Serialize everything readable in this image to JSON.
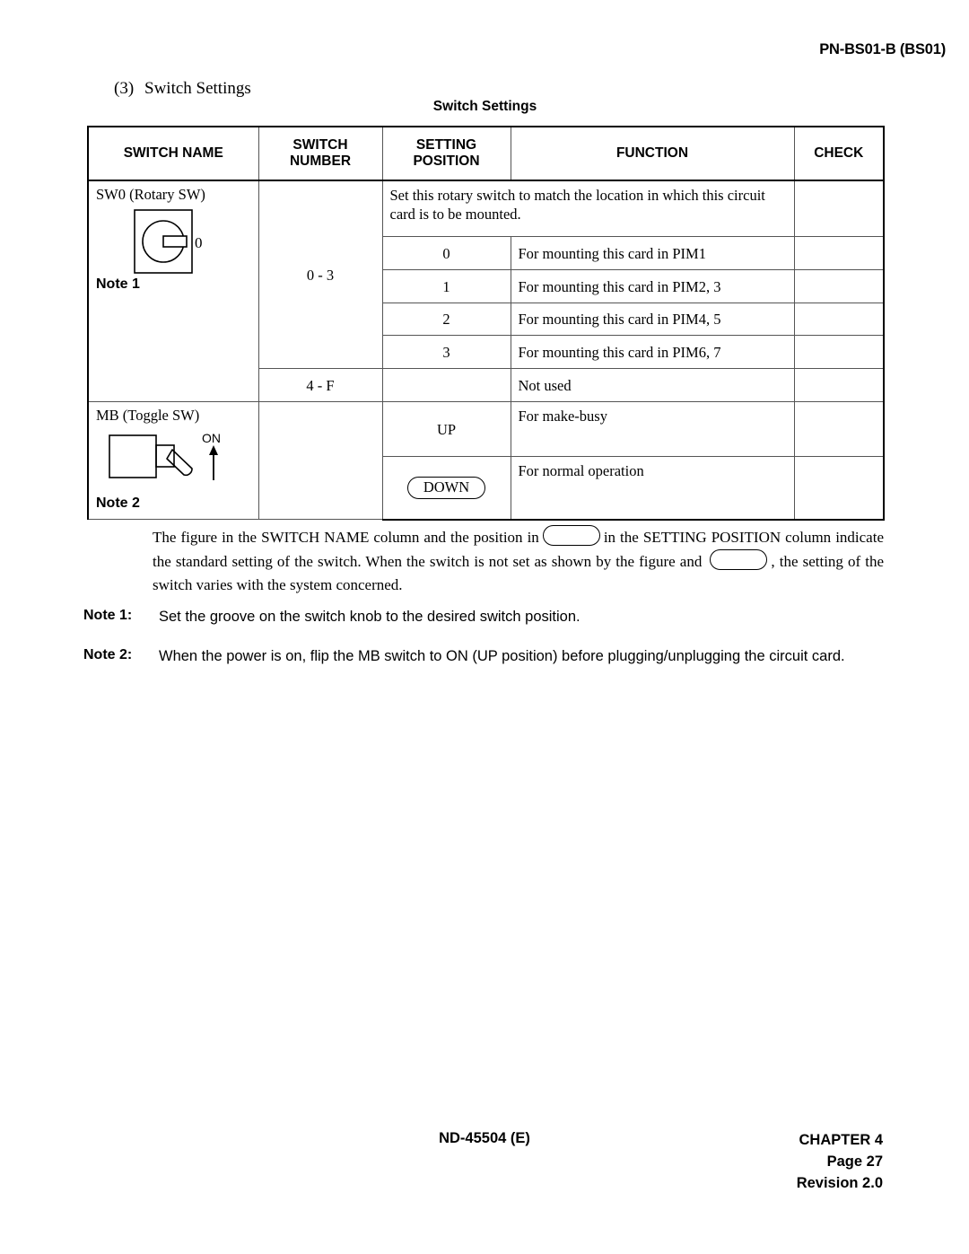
{
  "page_header": "PN-BS01-B (BS01)",
  "section": {
    "number": "(3)",
    "title": "Switch Settings"
  },
  "table_caption": "Switch Settings",
  "table": {
    "headers": {
      "switch_name": "SWITCH NAME",
      "switch_number_l1": "SWITCH",
      "switch_number_l2": "NUMBER",
      "setting_position_l1": "SETTING",
      "setting_position_l2": "POSITION",
      "function": "FUNCTION",
      "check": "CHECK"
    },
    "rows": {
      "sw0": {
        "name": "SW0 (Rotary SW)",
        "icon": "rotary-switch-icon",
        "knob_label": "0",
        "note_ref": "Note 1",
        "number_range": "0 - 3",
        "number_unused": "4 - F",
        "description": "Set this rotary switch to match the location in which this circuit card is to be mounted.",
        "settings": [
          {
            "position": "0",
            "function": "For mounting this card in PIM1"
          },
          {
            "position": "1",
            "function": "For mounting this card in PIM2, 3"
          },
          {
            "position": "2",
            "function": "For mounting this card in PIM4, 5"
          },
          {
            "position": "3",
            "function": "For mounting this card in PIM6, 7"
          }
        ],
        "unused_function": "Not used"
      },
      "mb": {
        "name": "MB (Toggle SW)",
        "icon": "toggle-switch-icon",
        "direction_label": "ON",
        "note_ref": "Note 2",
        "settings": [
          {
            "position": "UP",
            "position_circled": false,
            "function": "For make-busy"
          },
          {
            "position": "DOWN",
            "position_circled": true,
            "function": "For normal operation"
          }
        ]
      }
    }
  },
  "explanation": {
    "part1": "The figure in the SWITCH NAME column and the position in",
    "part2": "in the SETTING POSITION column indicate the standard setting of the switch. When the switch is not set as shown by the figure and",
    "part3": ", the setting of the switch varies with the system concerned."
  },
  "notes": [
    {
      "key": "Note 1:",
      "text": "Set the groove on the switch knob to the desired switch position."
    },
    {
      "key": "Note 2:",
      "text": "When the power is on, flip the MB switch to ON (UP position) before plugging/unplugging the circuit card."
    }
  ],
  "footer": {
    "document": "ND-45504 (E)",
    "chapter": "CHAPTER 4",
    "page": "Page 27",
    "revision": "Revision 2.0"
  }
}
